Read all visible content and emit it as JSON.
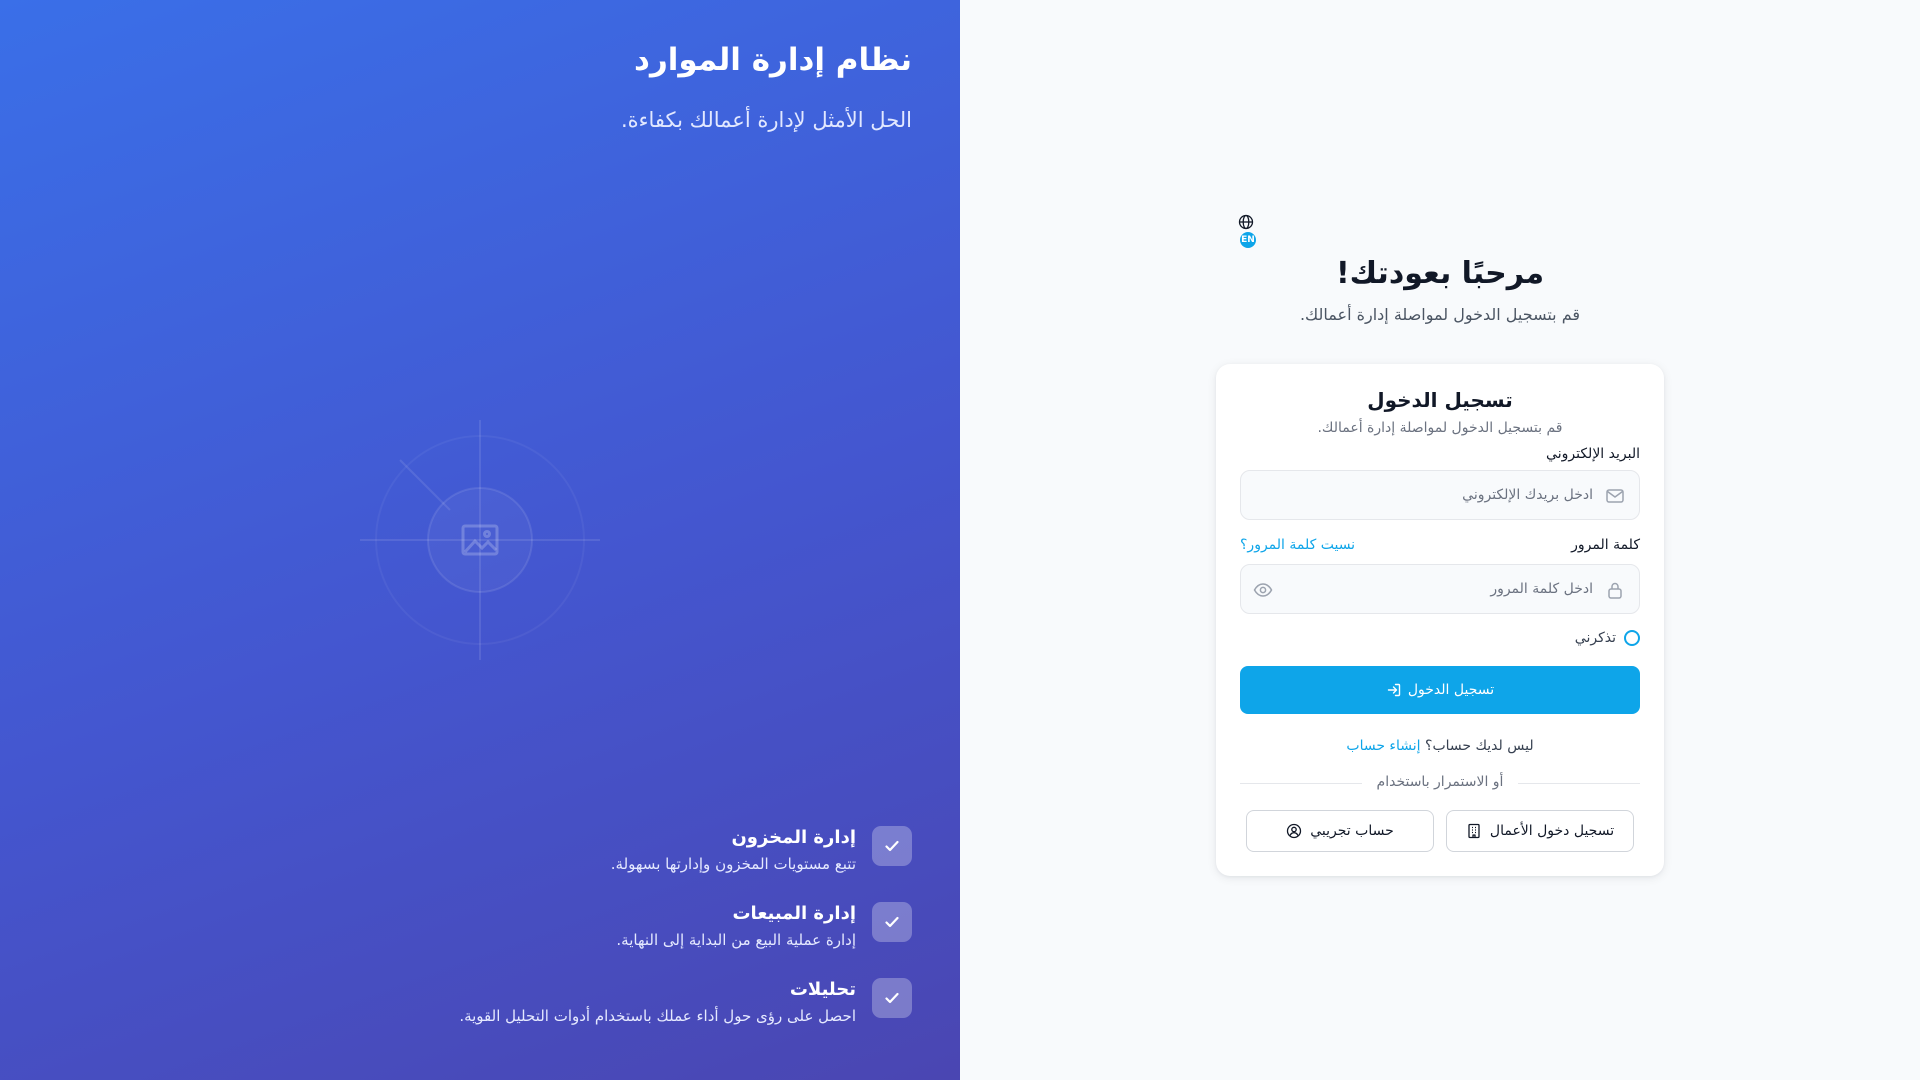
{
  "hero": {
    "title": "نظام إدارة الموارد",
    "subtitle": "الحل الأمثل لإدارة أعمالك بكفاءة.",
    "features": [
      {
        "title": "إدارة المخزون",
        "description": "تتبع مستويات المخزون وإدارتها بسهولة."
      },
      {
        "title": "إدارة المبيعات",
        "description": "إدارة عملية البيع من البداية إلى النهاية."
      },
      {
        "title": "تحليلات",
        "description": "احصل على رؤى حول أداء عملك باستخدام أدوات التحليل القوية."
      }
    ]
  },
  "language": {
    "badge": "EN",
    "icon": "globe-icon"
  },
  "welcome": {
    "title": "مرحبًا بعودتك!",
    "subtitle": "قم بتسجيل الدخول لمواصلة إدارة أعمالك."
  },
  "login_card": {
    "title": "تسجيل الدخول",
    "subtitle": "قم بتسجيل الدخول لمواصلة إدارة أعمالك.",
    "email": {
      "label": "البريد الإلكتروني",
      "placeholder": "ادخل بريدك الإلكتروني",
      "value": ""
    },
    "password": {
      "label": "كلمة المرور",
      "placeholder": "ادخل كلمة المرور",
      "value": ""
    },
    "forgot_password": "نسيت كلمة المرور؟",
    "remember_me": "تذكرني",
    "remember_checked": false,
    "submit_label": "تسجيل الدخول",
    "no_account_text": "ليس لديك حساب؟",
    "signup_link": "إنشاء حساب",
    "divider_text": "أو الاستمرار باستخدام",
    "business_login": "تسجيل دخول الأعمال",
    "demo_account": "حساب تجريبي"
  },
  "colors": {
    "accent": "#0ea5e9",
    "hero_gradient_start": "#3a6fe8",
    "hero_gradient_end": "#4a46b2",
    "page_background": "#f8fafc"
  }
}
